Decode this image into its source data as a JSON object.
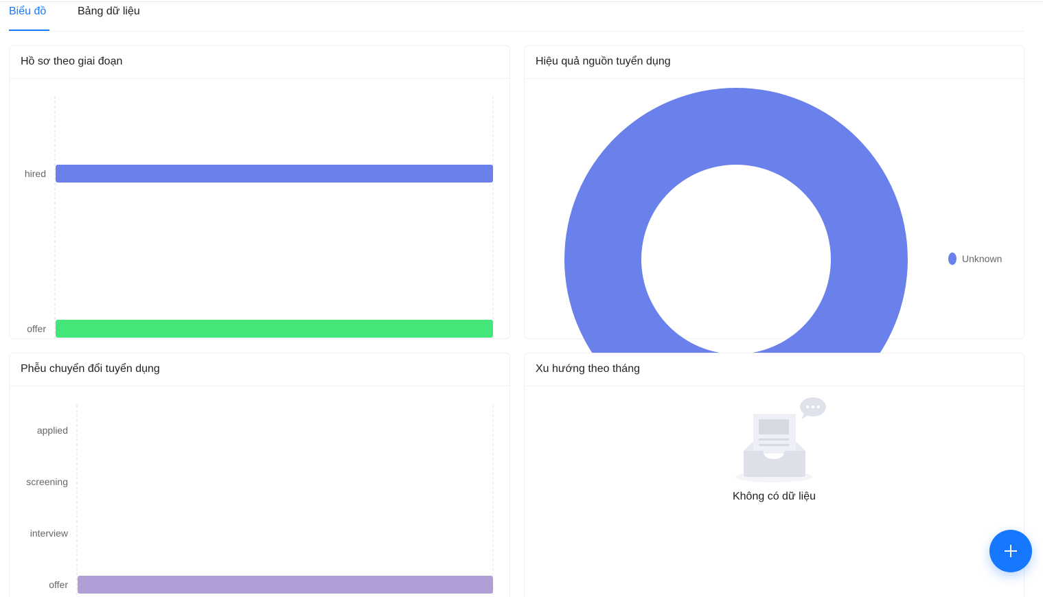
{
  "tabs": [
    {
      "label": "Biểu đồ",
      "active": true
    },
    {
      "label": "Bảng dữ liệu",
      "active": false
    }
  ],
  "cards": {
    "stage": {
      "title": "Hồ sơ theo giai đoạn"
    },
    "source": {
      "title": "Hiệu quả nguồn tuyển dụng"
    },
    "funnel": {
      "title": "Phễu chuyển đổi tuyển dụng"
    },
    "trend": {
      "title": "Xu hướng theo tháng",
      "empty_text": "Không có dữ liệu"
    }
  },
  "chart_data": [
    {
      "type": "bar",
      "orientation": "horizontal",
      "categories": [
        "hired",
        "offer"
      ],
      "values": [
        1,
        1
      ],
      "colors": [
        "#6a80ea",
        "#45e679"
      ]
    },
    {
      "type": "pie",
      "donut": true,
      "slices": [
        {
          "label": "Unknown",
          "value": 1,
          "color": "#6a80ea"
        }
      ],
      "legend": "right"
    },
    {
      "type": "bar",
      "orientation": "horizontal",
      "categories": [
        "applied",
        "screening",
        "interview",
        "offer"
      ],
      "values": [
        0,
        0,
        0,
        1
      ],
      "colors": [
        "#b09fd6",
        "#b09fd6",
        "#b09fd6",
        "#b09fd6"
      ]
    }
  ],
  "fab": {
    "icon": "plus-icon"
  },
  "colors": {
    "accent": "#1677ff"
  }
}
